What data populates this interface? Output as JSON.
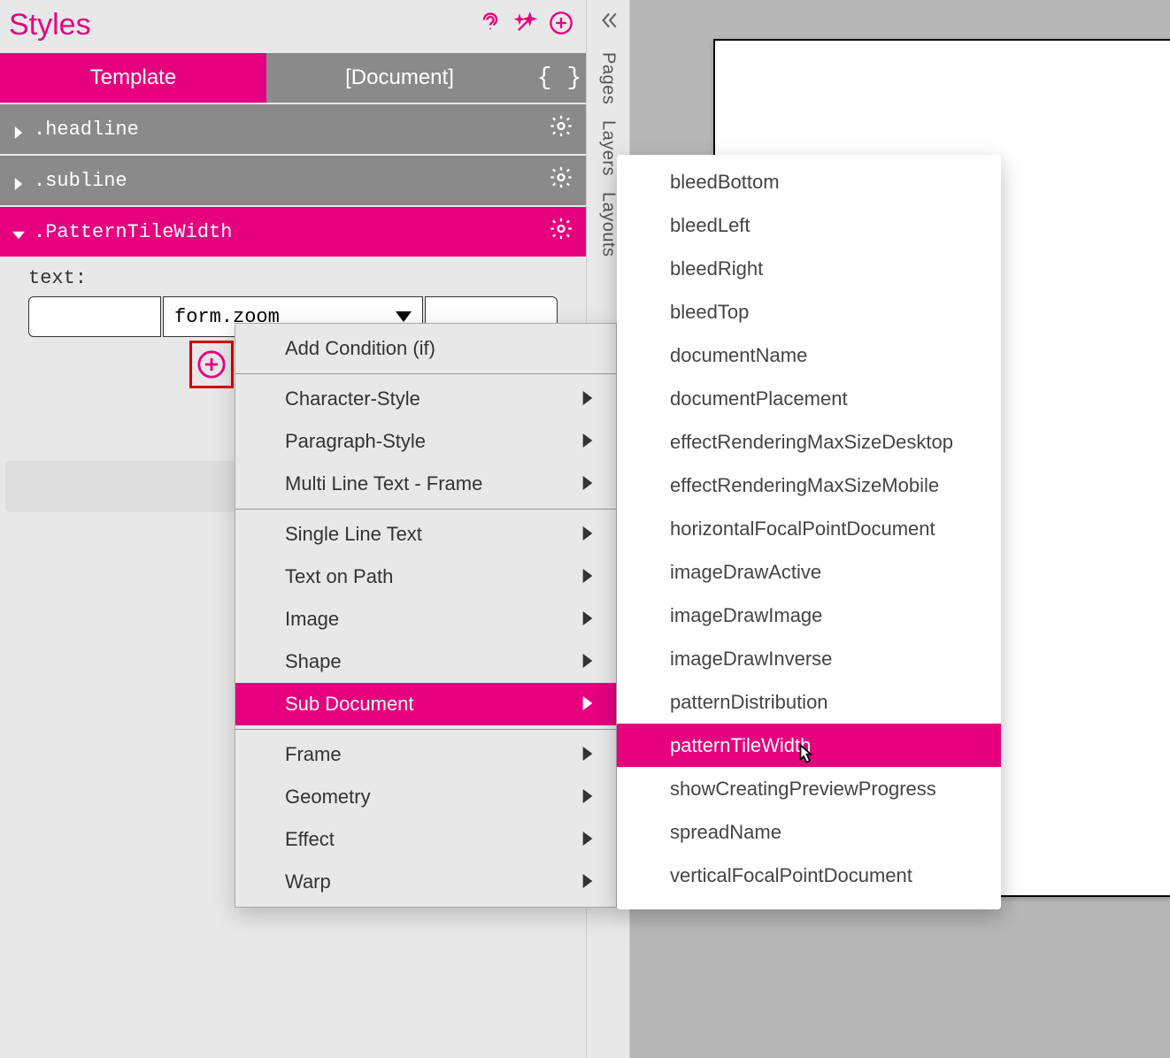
{
  "panel": {
    "title": "Styles"
  },
  "tabs": {
    "template": "Template",
    "document": "[Document]",
    "braces": "{ }"
  },
  "styles": [
    {
      "name": ".headline",
      "expanded": false
    },
    {
      "name": ".subline",
      "expanded": false
    },
    {
      "name": ".PatternTileWidth",
      "expanded": true
    }
  ],
  "prop": {
    "label": "text:",
    "select_value": "form.zoom"
  },
  "add_button_label": "Add",
  "vtabs": {
    "pages": "Pages",
    "layers": "Layers",
    "layouts": "Layouts"
  },
  "ctx": {
    "add_condition": "Add Condition (if)",
    "character_style": "Character-Style",
    "paragraph_style": "Paragraph-Style",
    "multi_line": "Multi Line Text - Frame",
    "single_line": "Single Line Text",
    "text_on_path": "Text on Path",
    "image": "Image",
    "shape": "Shape",
    "sub_document": "Sub Document",
    "frame": "Frame",
    "geometry": "Geometry",
    "effect": "Effect",
    "warp": "Warp"
  },
  "submenu": {
    "items": [
      "bleedBottom",
      "bleedLeft",
      "bleedRight",
      "bleedTop",
      "documentName",
      "documentPlacement",
      "effectRenderingMaxSizeDesktop",
      "effectRenderingMaxSizeMobile",
      "horizontalFocalPointDocument",
      "imageDrawActive",
      "imageDrawImage",
      "imageDrawInverse",
      "patternDistribution",
      "patternTileWidth",
      "showCreatingPreviewProgress",
      "spreadName",
      "verticalFocalPointDocument"
    ],
    "selected_index": 13
  }
}
